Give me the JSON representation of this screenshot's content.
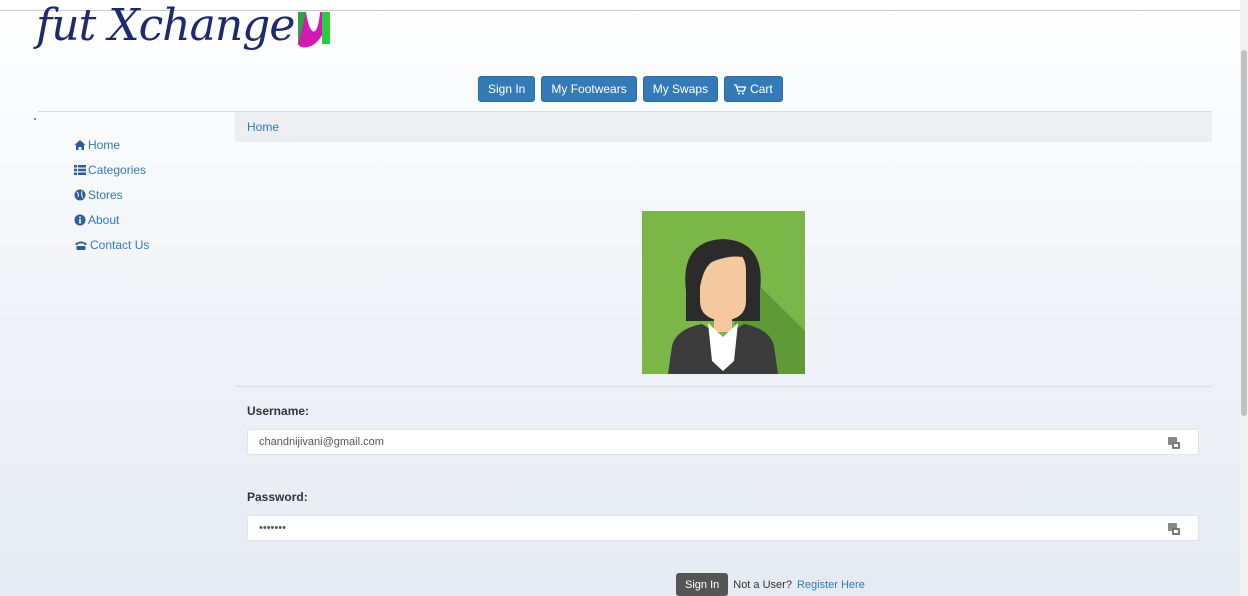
{
  "brand": {
    "logo_text": "fut Xchange"
  },
  "navbar": {
    "items": [
      {
        "label": "Sign In"
      },
      {
        "label": "My Footwears"
      },
      {
        "label": "My Swaps"
      },
      {
        "label": "Cart",
        "icon": "cart-icon"
      }
    ]
  },
  "sidebar": {
    "items": [
      {
        "label": "Home",
        "icon": "home-icon"
      },
      {
        "label": "Categories",
        "icon": "list-icon"
      },
      {
        "label": "Stores",
        "icon": "globe-icon"
      },
      {
        "label": "About",
        "icon": "info-icon"
      },
      {
        "label": "Contact Us",
        "icon": "phone-icon"
      }
    ]
  },
  "breadcrumb": {
    "current": "Home"
  },
  "form": {
    "username_label": "Username:",
    "username_value": "chandnijivani@gmail.com",
    "password_label": "Password:",
    "password_value": "•••••••",
    "submit_label": "Sign In",
    "prompt_text": "Not a User?",
    "register_label": "Register Here"
  },
  "colors": {
    "primary": "#337ab7",
    "avatar_bg": "#7ab648",
    "submit_bg": "#555555"
  }
}
